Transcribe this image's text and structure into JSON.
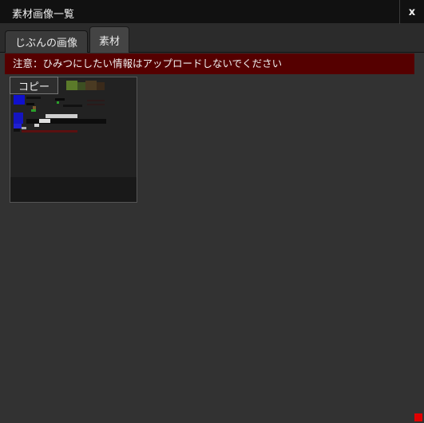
{
  "window": {
    "title": "素材画像一覧",
    "close_label": "x"
  },
  "tabs": [
    {
      "label": "じぶんの画像",
      "active": false
    },
    {
      "label": "素材",
      "active": true
    }
  ],
  "warning": {
    "text": "注意：ひみつにしたい情報はアップロードしないでください"
  },
  "gallery": {
    "items": [
      {
        "copy_label": "コピー"
      }
    ]
  },
  "colors": {
    "warning_bg": "#550000",
    "resize_handle": "#e00000"
  }
}
